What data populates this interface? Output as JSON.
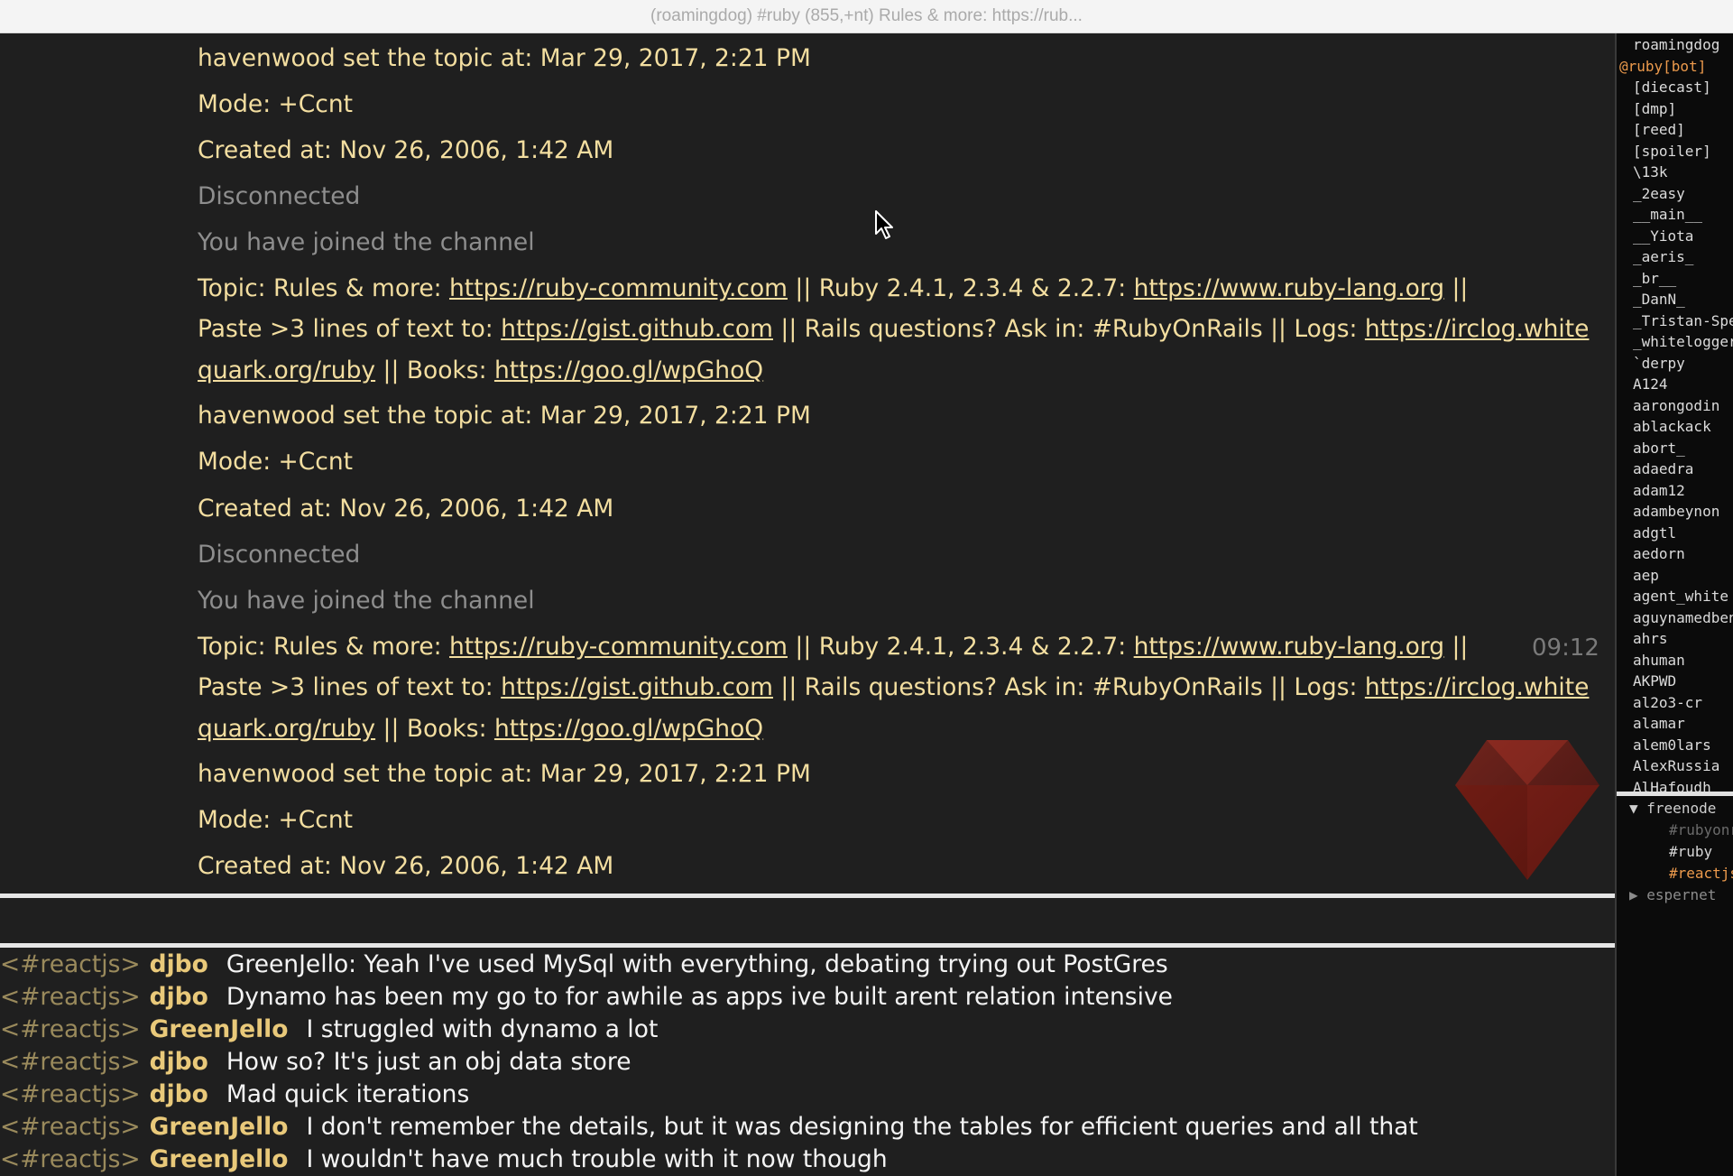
{
  "window": {
    "title": "(roamingdog) #ruby (855,+nt) Rules & more: https://rub..."
  },
  "main": {
    "timestamp": "09:12",
    "rows": [
      {
        "type": "notice",
        "parts": [
          {
            "text": "havenwood set the topic at: Mar 29, 2017, 2:21 PM"
          }
        ]
      },
      {
        "type": "notice",
        "parts": [
          {
            "text": "Mode: +Ccnt"
          }
        ]
      },
      {
        "type": "notice",
        "parts": [
          {
            "text": "Created at: Nov 26, 2006, 1:42 AM"
          }
        ]
      },
      {
        "type": "status",
        "parts": [
          {
            "text": "Disconnected"
          }
        ]
      },
      {
        "type": "status",
        "parts": [
          {
            "text": "You have joined the channel"
          }
        ]
      },
      {
        "type": "topic",
        "parts": [
          {
            "text": "Topic: Rules & more: "
          },
          {
            "text": "https://ruby-community.com",
            "link": true
          },
          {
            "text": " || Ruby 2.4.1, 2.3.4 & 2.2.7: "
          },
          {
            "text": "https://www.ruby-lang.org",
            "link": true
          },
          {
            "text": " ||"
          }
        ]
      },
      {
        "type": "topic",
        "parts": [
          {
            "text": "Paste >3 lines of text to: "
          },
          {
            "text": "https://gist.github.com",
            "link": true
          },
          {
            "text": " || Rails questions? Ask in: #RubyOnRails || Logs: "
          },
          {
            "text": "https://irclog.white",
            "link": true
          }
        ]
      },
      {
        "type": "topic",
        "parts": [
          {
            "text": "quark.org/ruby",
            "link": true
          },
          {
            "text": " || Books: "
          },
          {
            "text": "https://goo.gl/wpGhoQ",
            "link": true
          }
        ]
      },
      {
        "type": "notice",
        "parts": [
          {
            "text": "havenwood set the topic at: Mar 29, 2017, 2:21 PM"
          }
        ]
      },
      {
        "type": "notice",
        "parts": [
          {
            "text": "Mode: +Ccnt"
          }
        ]
      },
      {
        "type": "notice",
        "parts": [
          {
            "text": "Created at: Nov 26, 2006, 1:42 AM"
          }
        ]
      },
      {
        "type": "status",
        "parts": [
          {
            "text": "Disconnected"
          }
        ]
      },
      {
        "type": "status",
        "parts": [
          {
            "text": "You have joined the channel"
          }
        ]
      },
      {
        "type": "topic",
        "parts": [
          {
            "text": "Topic: Rules & more: "
          },
          {
            "text": "https://ruby-community.com",
            "link": true
          },
          {
            "text": " || Ruby 2.4.1, 2.3.4 & 2.2.7: "
          },
          {
            "text": "https://www.ruby-lang.org",
            "link": true
          },
          {
            "text": " ||"
          }
        ]
      },
      {
        "type": "topic",
        "parts": [
          {
            "text": "Paste >3 lines of text to: "
          },
          {
            "text": "https://gist.github.com",
            "link": true
          },
          {
            "text": " || Rails questions? Ask in: #RubyOnRails || Logs: "
          },
          {
            "text": "https://irclog.white",
            "link": true
          }
        ]
      },
      {
        "type": "topic",
        "parts": [
          {
            "text": "quark.org/ruby",
            "link": true
          },
          {
            "text": " || Books: "
          },
          {
            "text": "https://goo.gl/wpGhoQ",
            "link": true
          }
        ]
      },
      {
        "type": "notice",
        "parts": [
          {
            "text": "havenwood set the topic at: Mar 29, 2017, 2:21 PM"
          }
        ]
      },
      {
        "type": "notice",
        "parts": [
          {
            "text": "Mode: +Ccnt"
          }
        ]
      },
      {
        "type": "notice",
        "parts": [
          {
            "text": "Created at: Nov 26, 2006, 1:42 AM"
          }
        ]
      }
    ]
  },
  "chat": {
    "messages": [
      {
        "channel": "<#reactjs>",
        "nick": "djbo",
        "text": "GreenJello: Yeah I've used MySql with everything, debating trying out PostGres"
      },
      {
        "channel": "<#reactjs>",
        "nick": "djbo",
        "text": "Dynamo has been my go to for awhile as apps ive built arent relation intensive"
      },
      {
        "channel": "<#reactjs>",
        "nick": "GreenJello",
        "text": "I struggled with dynamo a lot"
      },
      {
        "channel": "<#reactjs>",
        "nick": "djbo",
        "text": "How so? It's just an obj data store"
      },
      {
        "channel": "<#reactjs>",
        "nick": "djbo",
        "text": "Mad quick iterations"
      },
      {
        "channel": "<#reactjs>",
        "nick": "GreenJello",
        "text": "I don't remember the details, but it was designing the tables for efficient queries and all that"
      },
      {
        "channel": "<#reactjs>",
        "nick": "GreenJello",
        "text": "I wouldn't have much trouble with it now though"
      }
    ]
  },
  "userlist": {
    "users": [
      {
        "name": "roamingdog"
      },
      {
        "name": "@ruby[bot]",
        "op": true
      },
      {
        "name": "[diecast]"
      },
      {
        "name": "[dmp]"
      },
      {
        "name": "[reed]"
      },
      {
        "name": "[spoiler]"
      },
      {
        "name": "\\13k"
      },
      {
        "name": "_2easy"
      },
      {
        "name": "__main__"
      },
      {
        "name": "__Yiota"
      },
      {
        "name": "_aeris_"
      },
      {
        "name": "_br__"
      },
      {
        "name": "_DanN_"
      },
      {
        "name": "_Tristan-Spee"
      },
      {
        "name": "_whitelogger"
      },
      {
        "name": "`derpy"
      },
      {
        "name": "A124"
      },
      {
        "name": "aarongodin"
      },
      {
        "name": "ablackack"
      },
      {
        "name": "abort_"
      },
      {
        "name": "adaedra"
      },
      {
        "name": "adam12"
      },
      {
        "name": "adambeynon"
      },
      {
        "name": "adgtl"
      },
      {
        "name": "aedorn"
      },
      {
        "name": "aep"
      },
      {
        "name": "agent_white"
      },
      {
        "name": "aguynamedben"
      },
      {
        "name": "ahrs"
      },
      {
        "name": "ahuman"
      },
      {
        "name": "AKPWD"
      },
      {
        "name": "al2o3-cr"
      },
      {
        "name": "alamar"
      },
      {
        "name": "alem0lars"
      },
      {
        "name": "AlexRussia"
      },
      {
        "name": "AlHafoudh"
      }
    ]
  },
  "servers": {
    "freenode": {
      "label": "freenode",
      "expanded": true,
      "channels": [
        {
          "label": "#rubyonr",
          "state": "dim"
        },
        {
          "label": "#ruby",
          "state": "normal"
        },
        {
          "label": "#reactjs",
          "state": "active"
        }
      ]
    },
    "espernet": {
      "label": "espernet",
      "expanded": false
    }
  },
  "colors": {
    "background": "#1f1f1f",
    "notice_text": "#f3dea0",
    "status_text": "#8e8e8e",
    "nick": "#e9c97a",
    "op_nick": "#ec9a4c",
    "ruby_red": "#9b1b10"
  },
  "icons": [
    "mouse-cursor-icon",
    "ruby-logo-icon",
    "disclosure-triangle-down-icon",
    "disclosure-triangle-right-icon"
  ]
}
